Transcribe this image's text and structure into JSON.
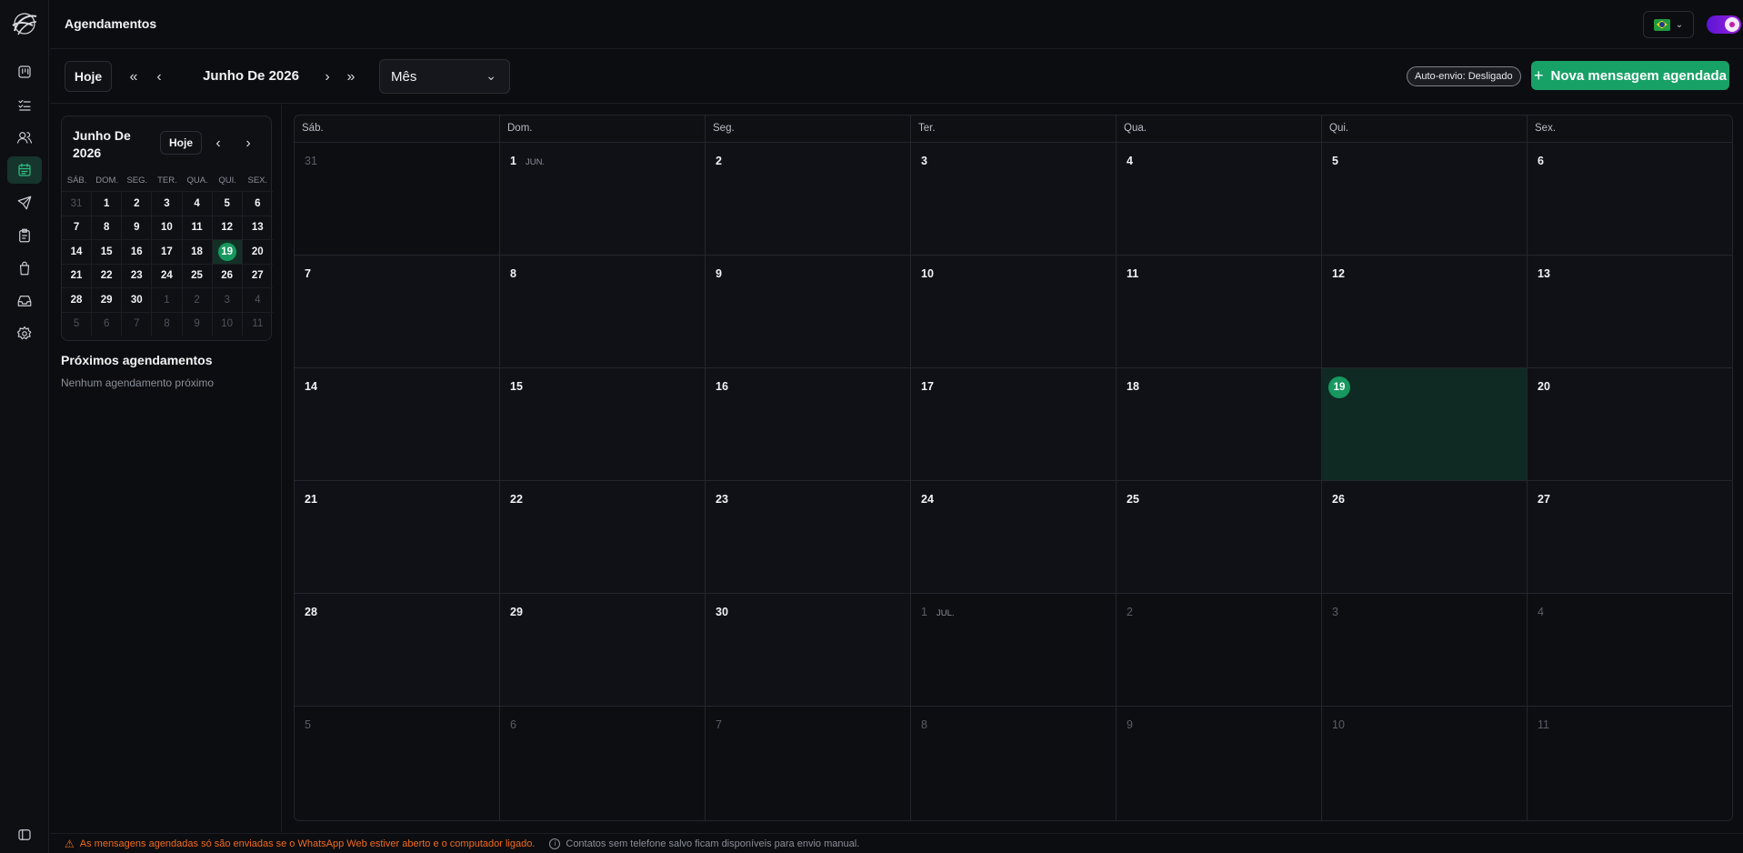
{
  "header": {
    "title": "Agendamentos"
  },
  "sidebar_icons": [
    "board-icon",
    "tasks-icon",
    "contacts-icon",
    "calendar-icon",
    "send-icon",
    "clipboard-icon",
    "bag-icon",
    "inbox-icon",
    "settings-icon"
  ],
  "toolbar": {
    "today_label": "Hoje",
    "month_label": "Junho De 2026",
    "view_select": "Mês",
    "auto_send": "Auto-envio: Desligado",
    "new_button": "Nova mensagem agendada"
  },
  "mini_calendar": {
    "title": "Junho De 2026",
    "today_label": "Hoje",
    "weekdays": [
      "SÁB.",
      "DOM.",
      "SEG.",
      "TER.",
      "QUA.",
      "QUI.",
      "SEX."
    ],
    "weeks": [
      [
        "31",
        "1",
        "2",
        "3",
        "4",
        "5",
        "6"
      ],
      [
        "7",
        "8",
        "9",
        "10",
        "11",
        "12",
        "13"
      ],
      [
        "14",
        "15",
        "16",
        "17",
        "18",
        "19",
        "20"
      ],
      [
        "21",
        "22",
        "23",
        "24",
        "25",
        "26",
        "27"
      ],
      [
        "28",
        "29",
        "30",
        "1",
        "2",
        "3",
        "4"
      ],
      [
        "5",
        "6",
        "7",
        "8",
        "9",
        "10",
        "11"
      ]
    ],
    "today": "19"
  },
  "upcoming": {
    "title": "Próximos agendamentos",
    "empty": "Nenhum agendamento próximo"
  },
  "calendar": {
    "weekdays": [
      "Sáb.",
      "Dom.",
      "Seg.",
      "Ter.",
      "Qua.",
      "Qui.",
      "Sex."
    ],
    "weeks": [
      [
        "31",
        "1",
        "2",
        "3",
        "4",
        "5",
        "6"
      ],
      [
        "7",
        "8",
        "9",
        "10",
        "11",
        "12",
        "13"
      ],
      [
        "14",
        "15",
        "16",
        "17",
        "18",
        "19",
        "20"
      ],
      [
        "21",
        "22",
        "23",
        "24",
        "25",
        "26",
        "27"
      ],
      [
        "28",
        "29",
        "30",
        "1",
        "2",
        "3",
        "4"
      ],
      [
        "5",
        "6",
        "7",
        "8",
        "9",
        "10",
        "11"
      ]
    ],
    "month_markers": {
      "jun": "JUN.",
      "jul": "JUL."
    },
    "today": "19"
  },
  "footer": {
    "warning": "As mensagens agendadas só são enviadas se o WhatsApp Web estiver aberto e o computador ligado.",
    "info": "Contatos sem telefone salvo ficam disponíveis para envio manual."
  },
  "colors": {
    "accent": "#18a167",
    "today": "#16985f",
    "warning": "#f26b1d",
    "toggle": "#7a1bd7"
  }
}
